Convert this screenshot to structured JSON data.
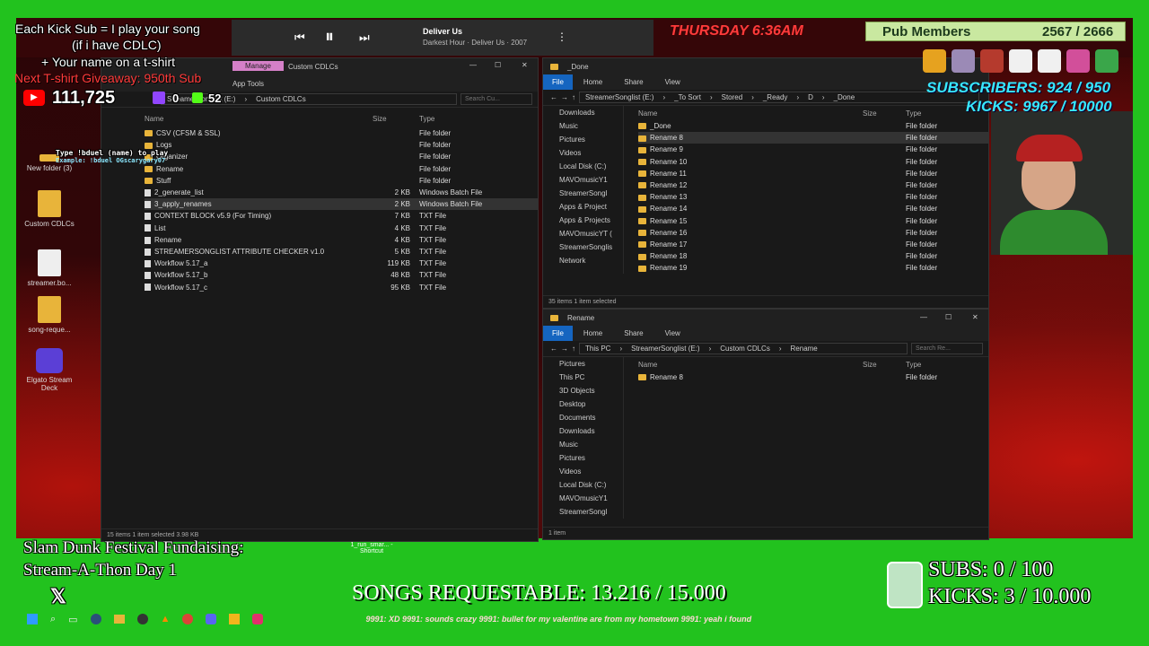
{
  "overlay": {
    "kick_sub_line1": "Each Kick Sub = I play your song",
    "kick_sub_line2": "(if i have CDLC)",
    "tshirt_line": "+ Your name on a t-shirt",
    "giveaway_line": "Next T-shirt Giveaway: 950th Sub",
    "youtube_count": "111,725",
    "twitch_count": "0",
    "kick_count": "52",
    "day_time": "THURSDAY 6:36AM",
    "pub_members_label": "Pub Members",
    "pub_members_count": "2567 / 2666",
    "subscribers_line": "SUBSCRIBERS: 924 / 950",
    "kicks_line": "KICKS: 9967 / 10000",
    "fundraising_line1": "Slam Dunk Festival Fundaising:",
    "fundraising_line2": "Stream-A-Thon Day 1",
    "songs_requestable": "SONGS REQUESTABLE: 13.216 / 15.000",
    "subs_goal": "SUBS:  0 / 100",
    "kicks_goal": "KICKS: 3 / 10.000",
    "chat_ticker": "9991: XD  9991: sounds crazy  9991: bullet for my valentine are from my hometown  9991: yeah i found"
  },
  "media_player": {
    "track_title": "Deliver Us",
    "track_subtitle": "Darkest Hour · Deliver Us · 2007"
  },
  "desktop_icons": [
    {
      "label": "New folder (3)"
    },
    {
      "label": "Custom CDLCs"
    },
    {
      "label": "streamer.bo..."
    },
    {
      "label": "song-reque..."
    },
    {
      "label": "Elgato Stream Deck"
    }
  ],
  "shortcut_label": "1_run_smar... - Shortcut",
  "left_explorer": {
    "title": "Custom CDLCs",
    "manage_tab": "Manage",
    "app_tools": "App Tools",
    "breadcrumb": [
      "StreamerSonglist (E:)",
      "Custom CDLCs"
    ],
    "search_placeholder": "Search Cu...",
    "col_name": "Name",
    "col_size": "Size",
    "col_type": "Type",
    "rows": [
      {
        "name": "CSV (CFSM & SSL)",
        "size": "",
        "type": "File folder",
        "kind": "folder"
      },
      {
        "name": "Logs",
        "size": "",
        "type": "File folder",
        "kind": "folder"
      },
      {
        "name": "Organizer",
        "size": "",
        "type": "File folder",
        "kind": "folder"
      },
      {
        "name": "Rename",
        "size": "",
        "type": "File folder",
        "kind": "folder"
      },
      {
        "name": "Stuff",
        "size": "",
        "type": "File folder",
        "kind": "folder"
      },
      {
        "name": "2_generate_list",
        "size": "2 KB",
        "type": "Windows Batch File",
        "kind": "file"
      },
      {
        "name": "3_apply_renames",
        "size": "2 KB",
        "type": "Windows Batch File",
        "kind": "file"
      },
      {
        "name": "CONTEXT BLOCK v5.9 (For Timing)",
        "size": "7 KB",
        "type": "TXT File",
        "kind": "file"
      },
      {
        "name": "List",
        "size": "4 KB",
        "type": "TXT File",
        "kind": "file"
      },
      {
        "name": "Rename",
        "size": "4 KB",
        "type": "TXT File",
        "kind": "file"
      },
      {
        "name": "STREAMERSONGLIST ATTRIBUTE CHECKER v1.0",
        "size": "5 KB",
        "type": "TXT File",
        "kind": "file"
      },
      {
        "name": "Workflow 5.17_a",
        "size": "119 KB",
        "type": "TXT File",
        "kind": "file"
      },
      {
        "name": "Workflow 5.17_b",
        "size": "48 KB",
        "type": "TXT File",
        "kind": "file"
      },
      {
        "name": "Workflow 5.17_c",
        "size": "95 KB",
        "type": "TXT File",
        "kind": "file"
      }
    ],
    "status": "15 items   1 item selected  3.98 KB"
  },
  "chat_popup": {
    "line1": "Type !bduel (name) to play",
    "line2": "Example: !bduel OGscarygary07"
  },
  "right_top_explorer": {
    "title": "_Done",
    "ribbon": [
      "File",
      "Home",
      "Share",
      "View"
    ],
    "breadcrumb": [
      "StreamerSonglist (E:)",
      "_To Sort",
      "Stored",
      "_Ready",
      "D",
      "_Done"
    ],
    "nav": [
      "Downloads",
      "Music",
      "Pictures",
      "Videos",
      "Local Disk (C:)",
      "MAVOmusicY1",
      "StreamerSongl",
      "Apps & Project",
      "Apps & Projects",
      "MAVOmusicYT (",
      "StreamerSonglis",
      "Network"
    ],
    "col_name": "Name",
    "col_size": "Size",
    "col_type": "Type",
    "rows": [
      "_Done",
      "Rename 8",
      "Rename 9",
      "Rename 10",
      "Rename 11",
      "Rename 12",
      "Rename 13",
      "Rename 14",
      "Rename 15",
      "Rename 16",
      "Rename 17",
      "Rename 18",
      "Rename 19"
    ],
    "row_type": "File folder",
    "status": "35 items   1 item selected"
  },
  "right_bottom_explorer": {
    "title": "Rename",
    "ribbon": [
      "File",
      "Home",
      "Share",
      "View"
    ],
    "breadcrumb": [
      "This PC",
      "StreamerSonglist (E:)",
      "Custom CDLCs",
      "Rename"
    ],
    "search_placeholder": "Search Re...",
    "nav": [
      "Pictures",
      "This PC",
      "3D Objects",
      "Desktop",
      "Documents",
      "Downloads",
      "Music",
      "Pictures",
      "Videos",
      "Local Disk (C:)",
      "MAVOmusicY1",
      "StreamerSongl"
    ],
    "col_name": "Name",
    "col_size": "Size",
    "col_type": "Type",
    "rows": [
      "Rename 8"
    ],
    "row_type": "File folder",
    "status": "1 item"
  },
  "colors": {
    "green_screen": "#22c21e",
    "accent_blue": "#1565c0",
    "folder_yellow": "#e8b43a",
    "kick_green": "#53fc18",
    "subs_cyan": "#38e8ff"
  }
}
